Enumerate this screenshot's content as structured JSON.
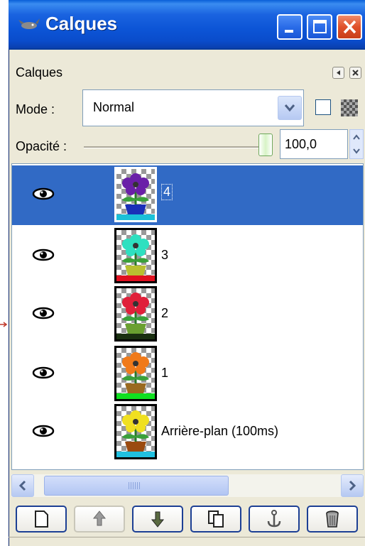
{
  "window": {
    "title": "Calques"
  },
  "panel": {
    "label": "Calques",
    "mode_label": "Mode :",
    "mode_value": "Normal",
    "opacity_label": "Opacité :",
    "opacity_value": "100,0",
    "opacity_level": 1.0
  },
  "layers": [
    {
      "name": "4",
      "selected": true,
      "visible": true,
      "flower": "#6a1fa8",
      "pot": "#1a2fb8",
      "strip": "#1ac0d8"
    },
    {
      "name": "3",
      "selected": false,
      "visible": true,
      "flower": "#2ee0c0",
      "pot": "#b8c030",
      "strip": "#e01020"
    },
    {
      "name": "2",
      "selected": false,
      "visible": true,
      "flower": "#e0203a",
      "pot": "#6aa030",
      "strip": "#1a3010"
    },
    {
      "name": "1",
      "selected": false,
      "visible": true,
      "flower": "#f07a1a",
      "pot": "#9a6a20",
      "strip": "#10e020"
    },
    {
      "name": "Arrière-plan (100ms)",
      "selected": false,
      "visible": true,
      "flower": "#f0e020",
      "pot": "#9a4a10",
      "strip": "#20c0e0"
    }
  ],
  "toolbar": {
    "buttons": [
      {
        "icon": "new-layer-icon"
      },
      {
        "icon": "raise-layer-icon"
      },
      {
        "icon": "lower-layer-icon"
      },
      {
        "icon": "duplicate-layer-icon"
      },
      {
        "icon": "anchor-layer-icon"
      },
      {
        "icon": "delete-layer-icon"
      }
    ]
  },
  "colors": {
    "titlebar": "#0c55d6",
    "selection": "#316ac5",
    "window_bg": "#ece9d8"
  }
}
